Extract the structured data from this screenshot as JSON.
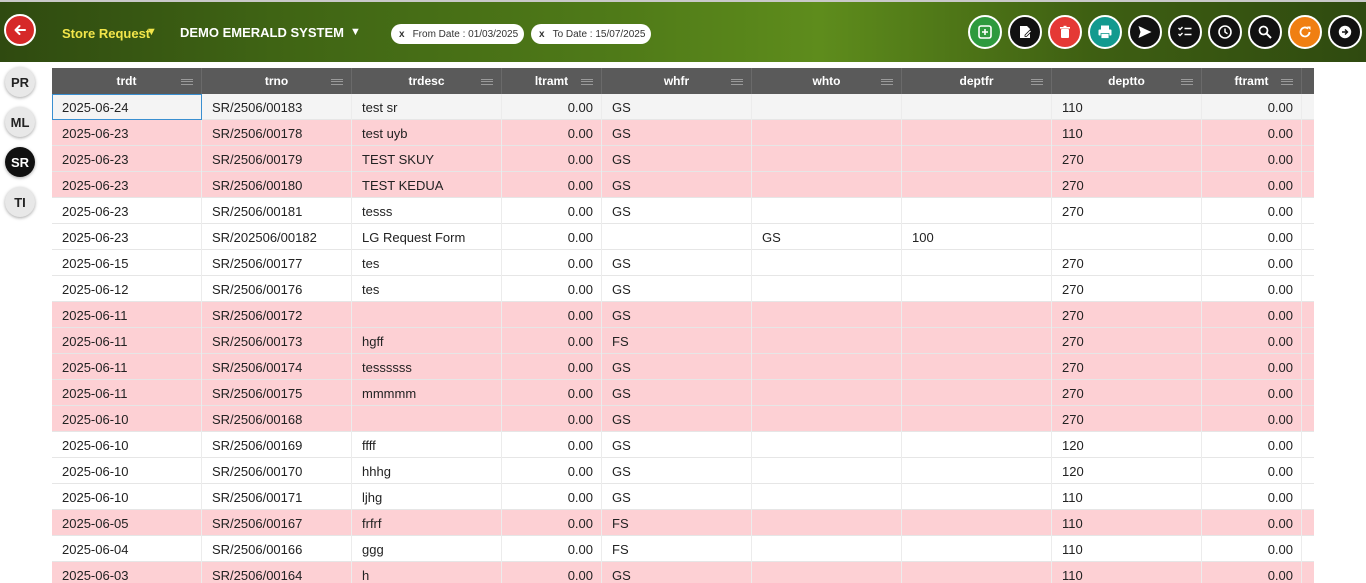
{
  "header": {
    "module": "Store Request",
    "company": "DEMO EMERALD SYSTEM",
    "filters": [
      {
        "remove": "x",
        "label": "From Date : 01/03/2025"
      },
      {
        "remove": "x",
        "label": "To Date : 15/07/2025"
      }
    ],
    "tools": [
      {
        "name": "add-icon",
        "color": "#2e9a3e"
      },
      {
        "name": "edit-icon",
        "color": "#111111"
      },
      {
        "name": "delete-icon",
        "color": "#e53935"
      },
      {
        "name": "print-icon",
        "color": "#129a8f"
      },
      {
        "name": "send-icon",
        "color": "#111111"
      },
      {
        "name": "checklist-icon",
        "color": "#111111"
      },
      {
        "name": "history-icon",
        "color": "#111111"
      },
      {
        "name": "search-icon",
        "color": "#111111"
      },
      {
        "name": "refresh-icon",
        "color": "#f07f12"
      },
      {
        "name": "logout-icon",
        "color": "#111111"
      }
    ]
  },
  "sidebar": {
    "items": [
      {
        "label": "PR",
        "active": false
      },
      {
        "label": "ML",
        "active": false
      },
      {
        "label": "SR",
        "active": true
      },
      {
        "label": "TI",
        "active": false
      }
    ]
  },
  "table": {
    "columns": [
      "trdt",
      "trno",
      "trdesc",
      "ltramt",
      "whfr",
      "whto",
      "deptfr",
      "deptto",
      "ftramt"
    ],
    "rows": [
      {
        "style": "sel",
        "cells": [
          "2025-06-24",
          "SR/2506/00183",
          "test sr",
          "0.00",
          "GS",
          "",
          "",
          "110",
          "0.00"
        ]
      },
      {
        "style": "pink",
        "cells": [
          "2025-06-23",
          "SR/2506/00178",
          "test uyb",
          "0.00",
          "GS",
          "",
          "",
          "110",
          "0.00"
        ]
      },
      {
        "style": "pink",
        "cells": [
          "2025-06-23",
          "SR/2506/00179",
          "TEST SKUY",
          "0.00",
          "GS",
          "",
          "",
          "270",
          "0.00"
        ]
      },
      {
        "style": "pink",
        "cells": [
          "2025-06-23",
          "SR/2506/00180",
          "TEST KEDUA",
          "0.00",
          "GS",
          "",
          "",
          "270",
          "0.00"
        ]
      },
      {
        "style": "white",
        "cells": [
          "2025-06-23",
          "SR/2506/00181",
          "tesss",
          "0.00",
          "GS",
          "",
          "",
          "270",
          "0.00"
        ]
      },
      {
        "style": "white",
        "cells": [
          "2025-06-23",
          "SR/202506/00182",
          "LG Request Form",
          "0.00",
          "",
          "GS",
          "100",
          "",
          "0.00"
        ]
      },
      {
        "style": "white",
        "cells": [
          "2025-06-15",
          "SR/2506/00177",
          "tes",
          "0.00",
          "GS",
          "",
          "",
          "270",
          "0.00"
        ]
      },
      {
        "style": "white",
        "cells": [
          "2025-06-12",
          "SR/2506/00176",
          "tes",
          "0.00",
          "GS",
          "",
          "",
          "270",
          "0.00"
        ]
      },
      {
        "style": "pink",
        "cells": [
          "2025-06-11",
          "SR/2506/00172",
          "",
          "0.00",
          "GS",
          "",
          "",
          "270",
          "0.00"
        ]
      },
      {
        "style": "pink",
        "cells": [
          "2025-06-11",
          "SR/2506/00173",
          "hgff",
          "0.00",
          "FS",
          "",
          "",
          "270",
          "0.00"
        ]
      },
      {
        "style": "pink",
        "cells": [
          "2025-06-11",
          "SR/2506/00174",
          "tessssss",
          "0.00",
          "GS",
          "",
          "",
          "270",
          "0.00"
        ]
      },
      {
        "style": "pink",
        "cells": [
          "2025-06-11",
          "SR/2506/00175",
          "mmmmm",
          "0.00",
          "GS",
          "",
          "",
          "270",
          "0.00"
        ]
      },
      {
        "style": "pink",
        "cells": [
          "2025-06-10",
          "SR/2506/00168",
          "",
          "0.00",
          "GS",
          "",
          "",
          "270",
          "0.00"
        ]
      },
      {
        "style": "white",
        "cells": [
          "2025-06-10",
          "SR/2506/00169",
          "ffff",
          "0.00",
          "GS",
          "",
          "",
          "120",
          "0.00"
        ]
      },
      {
        "style": "white",
        "cells": [
          "2025-06-10",
          "SR/2506/00170",
          "hhhg",
          "0.00",
          "GS",
          "",
          "",
          "120",
          "0.00"
        ]
      },
      {
        "style": "white",
        "cells": [
          "2025-06-10",
          "SR/2506/00171",
          "ljhg",
          "0.00",
          "GS",
          "",
          "",
          "110",
          "0.00"
        ]
      },
      {
        "style": "pink",
        "cells": [
          "2025-06-05",
          "SR/2506/00167",
          "frfrf",
          "0.00",
          "FS",
          "",
          "",
          "110",
          "0.00"
        ]
      },
      {
        "style": "white",
        "cells": [
          "2025-06-04",
          "SR/2506/00166",
          "ggg",
          "0.00",
          "FS",
          "",
          "",
          "110",
          "0.00"
        ]
      },
      {
        "style": "pink",
        "cells": [
          "2025-06-03",
          "SR/2506/00164",
          "h",
          "0.00",
          "GS",
          "",
          "",
          "110",
          "0.00"
        ]
      }
    ]
  }
}
